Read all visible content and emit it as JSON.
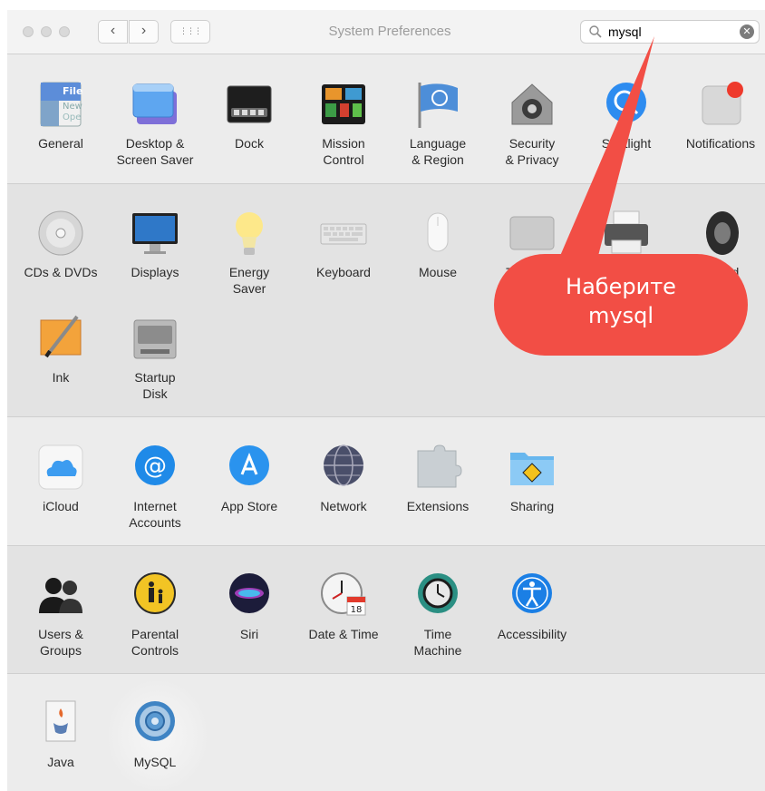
{
  "window": {
    "title": "System Preferences",
    "search": {
      "value": "mysql",
      "clear_symbol": "✕"
    },
    "nav": {
      "back": "‹",
      "forward": "›",
      "grid": "⋮⋮⋮"
    }
  },
  "callout": {
    "line1": "Наберите",
    "line2": "mysql",
    "color": "#f24e45"
  },
  "sections": {
    "personal": [
      {
        "label": "General",
        "icon": "general-icon"
      },
      {
        "label": "Desktop &\nScreen Saver",
        "icon": "desktop-icon"
      },
      {
        "label": "Dock",
        "icon": "dock-icon"
      },
      {
        "label": "Mission\nControl",
        "icon": "mission-control-icon"
      },
      {
        "label": "Language\n& Region",
        "icon": "language-icon"
      },
      {
        "label": "Security\n& Privacy",
        "icon": "security-icon"
      },
      {
        "label": "Spotlight",
        "icon": "spotlight-icon"
      },
      {
        "label": "Notifications",
        "icon": "notifications-icon"
      }
    ],
    "hardware": [
      {
        "label": "CDs & DVDs",
        "icon": "cd-icon"
      },
      {
        "label": "Displays",
        "icon": "display-icon"
      },
      {
        "label": "Energy\nSaver",
        "icon": "bulb-icon"
      },
      {
        "label": "Keyboard",
        "icon": "keyboard-icon"
      },
      {
        "label": "Mouse",
        "icon": "mouse-icon"
      },
      {
        "label": "Trackpad",
        "icon": "trackpad-icon"
      },
      {
        "label": "Printers &\nScanners",
        "icon": "printer-icon"
      },
      {
        "label": "Sound",
        "icon": "speaker-icon"
      },
      {
        "label": "Ink",
        "icon": "ink-icon"
      },
      {
        "label": "Startup\nDisk",
        "icon": "disk-icon"
      }
    ],
    "internet": [
      {
        "label": "iCloud",
        "icon": "icloud-icon"
      },
      {
        "label": "Internet\nAccounts",
        "icon": "at-icon"
      },
      {
        "label": "App Store",
        "icon": "appstore-icon"
      },
      {
        "label": "Network",
        "icon": "globe-icon"
      },
      {
        "label": "Extensions",
        "icon": "puzzle-icon"
      },
      {
        "label": "Sharing",
        "icon": "folder-icon"
      }
    ],
    "system": [
      {
        "label": "Users &\nGroups",
        "icon": "users-icon"
      },
      {
        "label": "Parental\nControls",
        "icon": "parental-icon"
      },
      {
        "label": "Siri",
        "icon": "siri-icon"
      },
      {
        "label": "Date & Time",
        "icon": "clock-icon"
      },
      {
        "label": "Time\nMachine",
        "icon": "time-machine-icon"
      },
      {
        "label": "Accessibility",
        "icon": "accessibility-icon"
      }
    ],
    "other": [
      {
        "label": "Java",
        "icon": "java-icon"
      },
      {
        "label": "MySQL",
        "icon": "mysql-icon"
      }
    ]
  }
}
